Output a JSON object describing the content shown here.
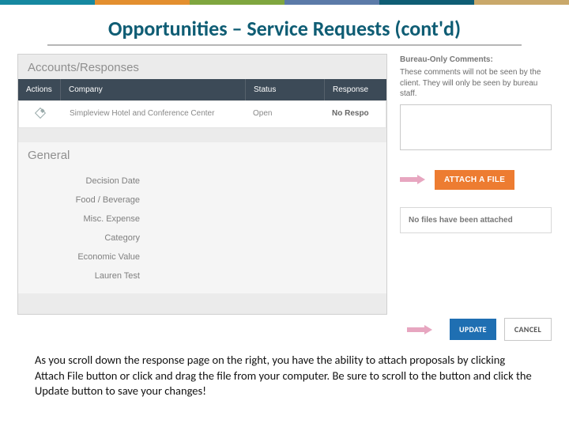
{
  "slide": {
    "title": "Opportunities – Service Requests (cont'd)"
  },
  "left_panel": {
    "accounts_responses_header": "Accounts/Responses",
    "columns": {
      "actions": "Actions",
      "company": "Company",
      "status": "Status",
      "response": "Response"
    },
    "row": {
      "company": "Simpleview Hotel and Conference Center",
      "status": "Open",
      "response": "No Respo"
    },
    "general_header": "General",
    "general_fields": {
      "decision_date": "Decision Date",
      "food_bev": "Food / Beverage",
      "misc_expense": "Misc. Expense",
      "category": "Category",
      "economic_value": "Economic Value",
      "lauren_test": "Lauren Test"
    }
  },
  "right_panel": {
    "boc_title": "Bureau-Only Comments:",
    "boc_text": "These comments will not be seen by the client. They will only be seen by bureau staff.",
    "attach_btn": "ATTACH A FILE",
    "no_files": "No files have been attached",
    "update_btn": "UPDATE",
    "cancel_btn": "CANCEL"
  },
  "caption": "As you scroll down the response page on the right, you have the ability to attach proposals by clicking Attach File button or click and drag the file from your computer. Be sure to scroll to the button and click the Update button to save your changes!"
}
